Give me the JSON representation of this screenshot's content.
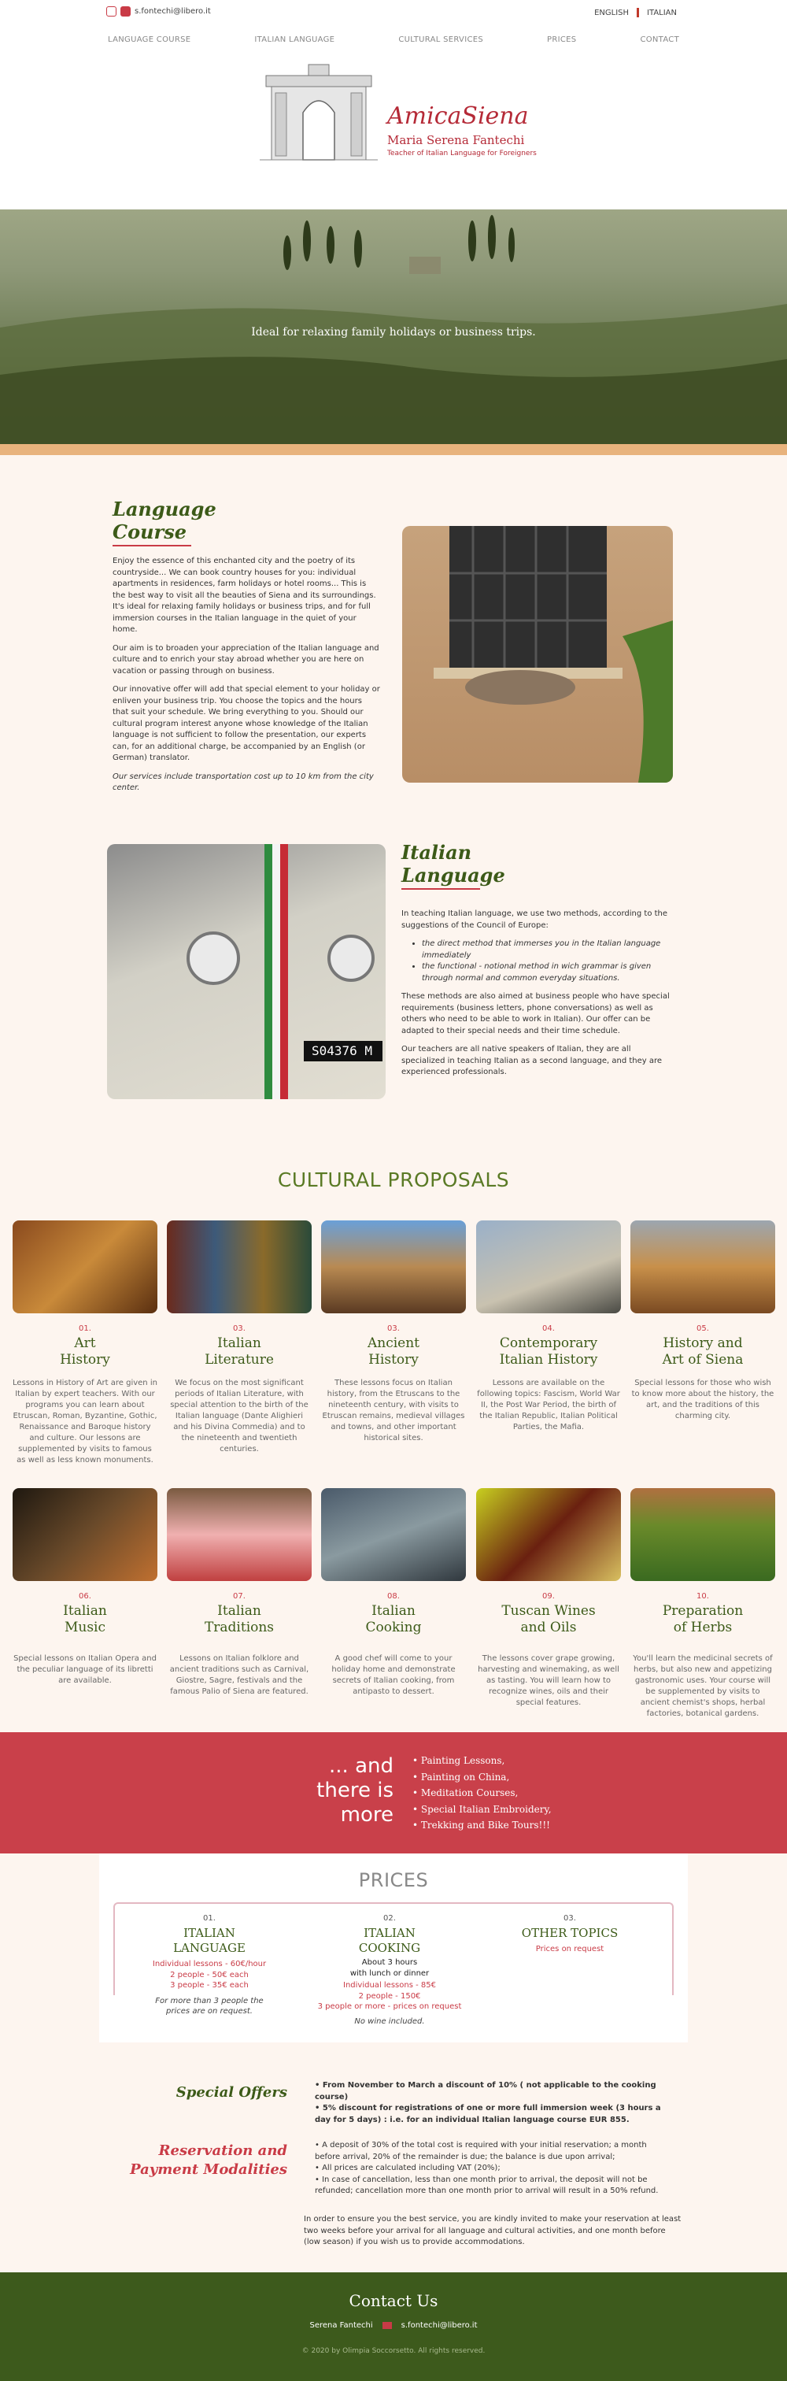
{
  "topbar": {
    "email": "s.fontechi@libero.it",
    "lang_en": "ENGLISH",
    "lang_it": "ITALIAN"
  },
  "nav": [
    "LANGUAGE COURSE",
    "ITALIAN LANGUAGE",
    "CULTURAL SERVICES",
    "PRICES",
    "CONTACT"
  ],
  "logo": {
    "brand": "AmicaSiena",
    "name": "Maria Serena Fantechi",
    "tagline": "Teacher of Italian Language for Foreigners"
  },
  "hero": {
    "caption": "Ideal for relaxing family holidays or business trips."
  },
  "course": {
    "title_line1": "Language",
    "title_line2": "Course",
    "p1": "Enjoy the essence of this enchanted city and the poetry of its countryside... We can book country houses for you: individual apartments in residences, farm holidays or hotel rooms... This is the best way to visit all the beauties of Siena and its surroundings. It's ideal for relaxing family holidays or business trips, and for full immersion courses in the Italian language in the quiet of your home.",
    "p2": "Our aim is to broaden your appreciation of the Italian language and culture and to enrich your stay abroad whether you are here on vacation or passing through on business.",
    "p3": "Our innovative offer will add that special element to your holiday or enliven your business trip. You choose the topics and the hours that suit your schedule. We bring everything to you. Should our cultural program interest anyone whose knowledge of the Italian language is not sufficient to follow the presentation, our experts can, for an additional charge, be accompanied by an English (or German) translator.",
    "p4": "Our services include transportation cost up to 10 km from the city center."
  },
  "language": {
    "title_line1": "Italian",
    "title_line2": "Language",
    "intro": "In teaching Italian language, we use two methods, according to the suggestions of the Council of Europe:",
    "bullets": [
      "the direct method that immerses you in the Italian language immediately",
      "the functional - notional method in wich grammar is given through normal and common everyday situations."
    ],
    "p2": "These methods are also aimed at business people who have special requirements (business letters, phone conversations) as well as others who need to be able to work in Italian). Our offer can be adapted to their special needs and their time schedule.",
    "p3": "Our teachers are all native speakers of Italian, they are all specialized in teaching Italian as a second language, and they are experienced professionals."
  },
  "cultural": {
    "title": "CULTURAL PROPOSALS",
    "cards": [
      {
        "num": "01.",
        "t1": "Art",
        "t2": "History",
        "desc": "Lessons in History of Art are given in Italian by expert teachers. With our programs you can learn about Etruscan, Roman, Byzantine, Gothic, Renaissance and Baroque history and culture. Our lessons are supplemented by visits to famous as well as less known monuments."
      },
      {
        "num": "03.",
        "t1": "Italian",
        "t2": "Literature",
        "desc": "We focus on the most significant periods of Italian Literature, with special attention to the birth of the Italian language (Dante Alighieri and his Divina Commedia) and to the nineteenth and twentieth centuries."
      },
      {
        "num": "03.",
        "t1": "Ancient",
        "t2": "History",
        "desc": "These lessons focus on Italian history, from the Etruscans to the nineteenth century, with visits to Etruscan remains, medieval villages and towns, and other important historical sites."
      },
      {
        "num": "04.",
        "t1": "Contemporary",
        "t2": "Italian History",
        "desc": "Lessons are available on the following topics: Fascism, World War II, the Post War Period, the birth of the Italian Republic, Italian Political Parties, the Mafia."
      },
      {
        "num": "05.",
        "t1": "History and",
        "t2": "Art of Siena",
        "desc": "Special lessons for those who wish to know more about the history, the art, and the traditions of this charming city."
      },
      {
        "num": "06.",
        "t1": "Italian",
        "t2": "Music",
        "desc": "Special lessons on Italian Opera and the peculiar language of its libretti are available."
      },
      {
        "num": "07.",
        "t1": "Italian",
        "t2": "Traditions",
        "desc": "Lessons on Italian folklore and ancient traditions such as Carnival, Giostre, Sagre, festivals and the famous Palio of Siena are featured."
      },
      {
        "num": "08.",
        "t1": "Italian",
        "t2": "Cooking",
        "desc": "A good chef will come to your holiday home and demonstrate secrets of Italian cooking, from antipasto to dessert."
      },
      {
        "num": "09.",
        "t1": "Tuscan Wines",
        "t2": "and Oils",
        "desc": "The lessons cover grape growing, harvesting and winemaking, as well as tasting. You will learn how to recognize wines, oils and their special features."
      },
      {
        "num": "10.",
        "t1": "Preparation",
        "t2": "of Herbs",
        "desc": "You'll learn the medicinal secrets of herbs, but also new and appetizing gastronomic uses. Your course will be supplemented by visits to ancient chemist's shops, herbal factories, botanical gardens."
      }
    ]
  },
  "more": {
    "l1": "... and",
    "l2": "there is",
    "l3": "more",
    "items": [
      "Painting Lessons,",
      "Painting on China,",
      "Meditation Courses,",
      "Special Italian Embroidery,",
      "Trekking and Bike Tours!!!"
    ]
  },
  "prices": {
    "title": "PRICES",
    "c1": {
      "num": "01.",
      "t1": "ITALIAN",
      "t2": "LANGUAGE",
      "r1": "Individual lessons - 60€/hour",
      "r2": "2 people - 50€ each",
      "r3": "3 people - 35€ each",
      "note": "For more than 3 people the prices are on request."
    },
    "c2": {
      "num": "02.",
      "t1": "ITALIAN",
      "t2": "COOKING",
      "sub1": "About 3 hours",
      "sub2": "with lunch or dinner",
      "r1": "Individual lessons - 85€",
      "r2": "2 people - 150€",
      "r3": "3 people or more - prices on request",
      "note": "No wine included."
    },
    "c3": {
      "num": "03.",
      "t1": "OTHER TOPICS",
      "r1": "Prices on request"
    }
  },
  "special": {
    "title": "Special Offers",
    "items": [
      "From November to March a discount of 10% ( not applicable to the cooking course)",
      "5% discount for registrations of one or more full immersion week (3 hours a day for 5 days) : i.e. for an individual Italian language course EUR 855."
    ]
  },
  "reservation": {
    "title1": "Reservation and",
    "title2": "Payment Modalities",
    "items": [
      "A deposit of 30% of the total cost is required with your initial reservation; a month before arrival, 20% of the remainder is due; the balance is due upon arrival;",
      "All prices are calculated including VAT (20%);",
      "In case of cancellation, less than one month prior to arrival, the deposit will not be refunded; cancellation more than one month prior to arrival will result in a 50% refund."
    ],
    "note": "In order to ensure you the best service, you are kindly invited to make your reservation at least two weeks before your arrival for all language and cultural activities, and one month before (low season) if you wish us to provide accommodations."
  },
  "footer": {
    "title": "Contact Us",
    "name": "Serena Fantechi",
    "email": "s.fontechi@libero.it",
    "copy": "© 2020 by Olimpia Soccorsetto. All rights reserved."
  }
}
